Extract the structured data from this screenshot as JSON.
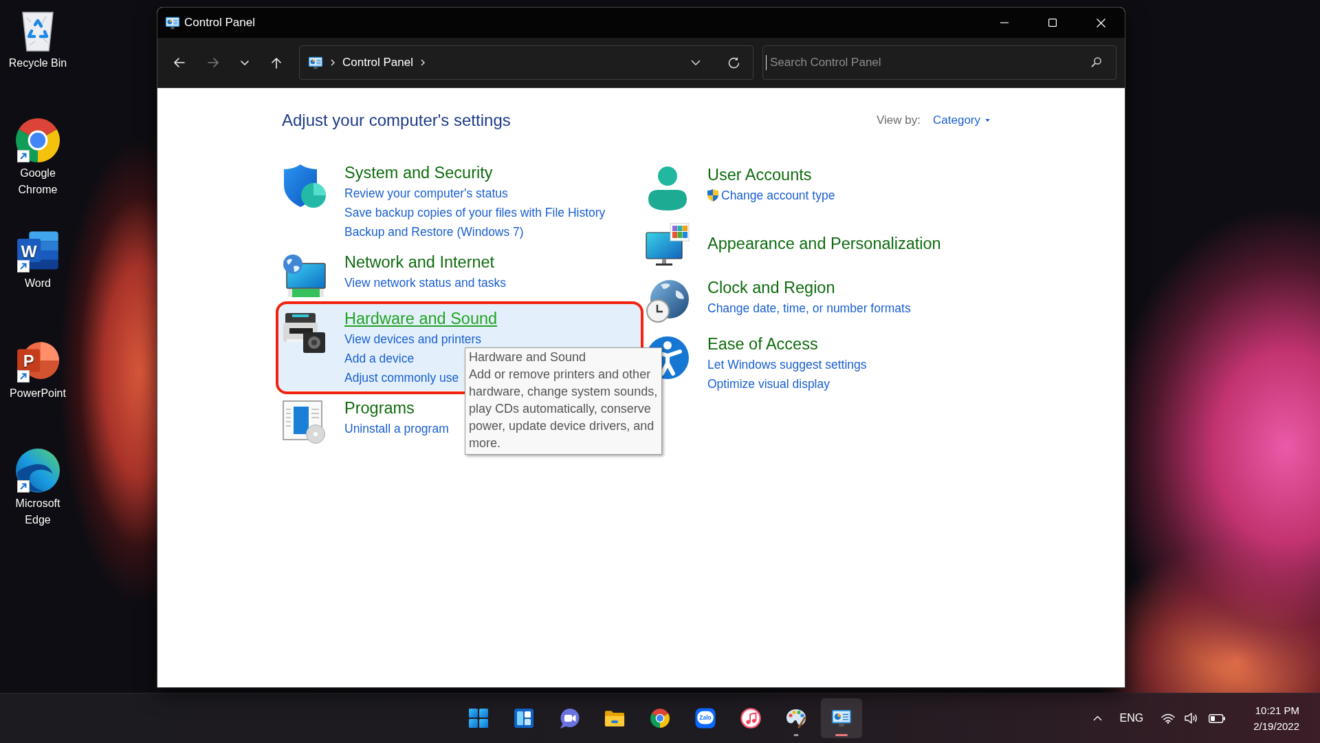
{
  "desktop_icons": [
    {
      "kind": "recycle-bin",
      "label": "Recycle Bin",
      "shortcut": false
    },
    {
      "kind": "chrome",
      "label": "Google Chrome",
      "shortcut": true
    },
    {
      "kind": "word",
      "label": "Word",
      "logo_text": "W",
      "shortcut": true
    },
    {
      "kind": "powerpoint",
      "label": "PowerPoint",
      "logo_text": "P",
      "shortcut": true
    },
    {
      "kind": "edge",
      "label": "Microsoft Edge",
      "shortcut": true
    }
  ],
  "window": {
    "title": "Control Panel"
  },
  "toolbar": {
    "nav_buttons": [
      {
        "kind": "back",
        "disabled": false
      },
      {
        "kind": "forward",
        "disabled": true
      },
      {
        "kind": "recent",
        "disabled": false
      },
      {
        "kind": "up",
        "disabled": false
      }
    ],
    "address": {
      "breadcrumb": [
        "Control Panel"
      ]
    },
    "search": {
      "placeholder": "Search Control Panel",
      "focused": true
    }
  },
  "content": {
    "heading": "Adjust your computer's settings",
    "view_by": {
      "label": "View by:",
      "value": "Category"
    },
    "category_columns": [
      {
        "categories": [
          {
            "kind": "system-security",
            "title": "System and Security",
            "hovered": false,
            "annotated": false,
            "links": [
              {
                "text": "Review your computer's status",
                "shield": false
              },
              {
                "text": "Save backup copies of your files with File History",
                "shield": false
              },
              {
                "text": "Backup and Restore (Windows 7)",
                "shield": false
              }
            ]
          },
          {
            "kind": "network",
            "title": "Network and Internet",
            "hovered": false,
            "annotated": false,
            "links": [
              {
                "text": "View network status and tasks",
                "shield": false
              }
            ]
          },
          {
            "kind": "hardware",
            "title": "Hardware and Sound",
            "hovered": true,
            "annotated": true,
            "links": [
              {
                "text": "View devices and printers",
                "shield": false
              },
              {
                "text": "Add a device",
                "shield": false
              },
              {
                "text": "Adjust commonly use",
                "shield": false
              }
            ]
          },
          {
            "kind": "programs",
            "title": "Programs",
            "hovered": false,
            "annotated": false,
            "links": [
              {
                "text": "Uninstall a program",
                "shield": false
              }
            ]
          }
        ]
      },
      {
        "categories": [
          {
            "kind": "user-accounts",
            "title": "User Accounts",
            "hovered": false,
            "annotated": false,
            "links": [
              {
                "text": "Change account type",
                "shield": true
              }
            ]
          },
          {
            "kind": "appearance",
            "title": "Appearance and Personalization",
            "hovered": false,
            "annotated": false
          },
          {
            "kind": "clock-region",
            "title": "Clock and Region",
            "hovered": false,
            "annotated": false,
            "links": [
              {
                "text": "Change date, time, or number formats",
                "shield": false
              }
            ]
          },
          {
            "kind": "ease-access",
            "title": "Ease of Access",
            "hovered": false,
            "annotated": false,
            "links": [
              {
                "text": "Let Windows suggest settings",
                "shield": false
              },
              {
                "text": "Optimize visual display",
                "shield": false
              }
            ]
          }
        ]
      }
    ]
  },
  "tooltip": {
    "title": "Hardware and Sound",
    "lines": [
      "Add or remove printers and other",
      "hardware, change system sounds,",
      "play CDs automatically, conserve",
      "power, update device drivers, and",
      "more."
    ]
  },
  "taskbar": {
    "apps": [
      {
        "kind": "start",
        "running": false,
        "active": false
      },
      {
        "kind": "widgets",
        "running": false,
        "active": false
      },
      {
        "kind": "chat",
        "running": false,
        "active": false
      },
      {
        "kind": "file-explorer",
        "running": false,
        "active": false
      },
      {
        "kind": "chrome",
        "running": false,
        "active": false
      },
      {
        "kind": "zalo",
        "logo_text": "Zalo",
        "running": false,
        "active": false
      },
      {
        "kind": "music",
        "running": false,
        "active": false
      },
      {
        "kind": "paint",
        "running": true,
        "active": false
      },
      {
        "kind": "control-panel",
        "running": true,
        "active": true
      }
    ],
    "tray": {
      "language": "ENG",
      "time": "10:21 PM",
      "date": "2/19/2022"
    }
  }
}
